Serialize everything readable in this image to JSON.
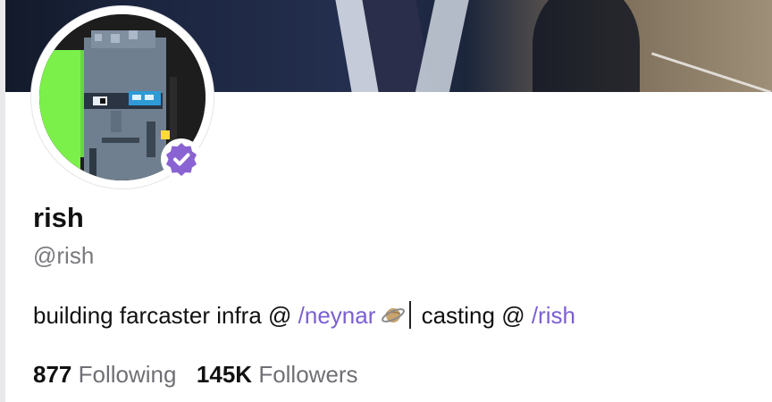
{
  "profile": {
    "display_name": "rish",
    "handle": "@rish",
    "verified_icon": "verified-badge-icon",
    "bio": {
      "text_1": "building farcaster infra @ ",
      "link_1": "/neynar",
      "emoji_1": "ringed-planet-icon",
      "text_2": " casting @ ",
      "link_2": "/rish"
    },
    "stats": {
      "following_count": "877",
      "following_label": "Following",
      "followers_count": "145K",
      "followers_label": "Followers"
    }
  },
  "colors": {
    "accent_link": "#7c5fd3",
    "verified_badge": "#8a63d2",
    "muted_text": "#7a7a7f",
    "avatar_bg_green": "#7cf04a"
  }
}
